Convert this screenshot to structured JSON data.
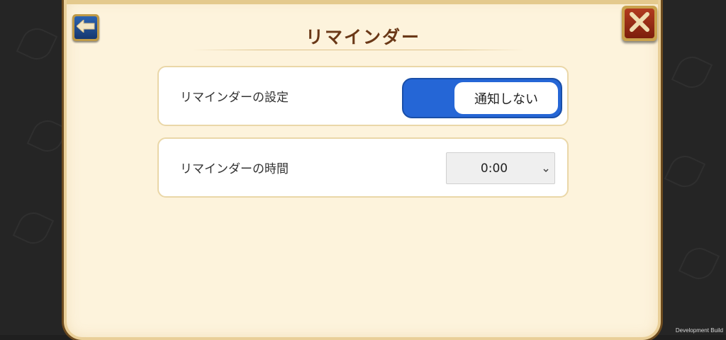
{
  "header": {
    "title": "リマインダー",
    "back_icon": "left-arrow-icon",
    "close_icon": "close-x-icon"
  },
  "settings": {
    "reminder_setting": {
      "label": "リマインダーの設定",
      "toggle_value": "通知しない"
    },
    "reminder_time": {
      "label": "リマインダーの時間",
      "selected": "0:00"
    }
  },
  "footer": {
    "build_label": "Development Build"
  },
  "colors": {
    "panel": "#fdf3dc",
    "title": "#6a3817",
    "toggle_accent": "#2566d6",
    "close_button": "#b23a1f",
    "back_button": "#2c64b2"
  }
}
